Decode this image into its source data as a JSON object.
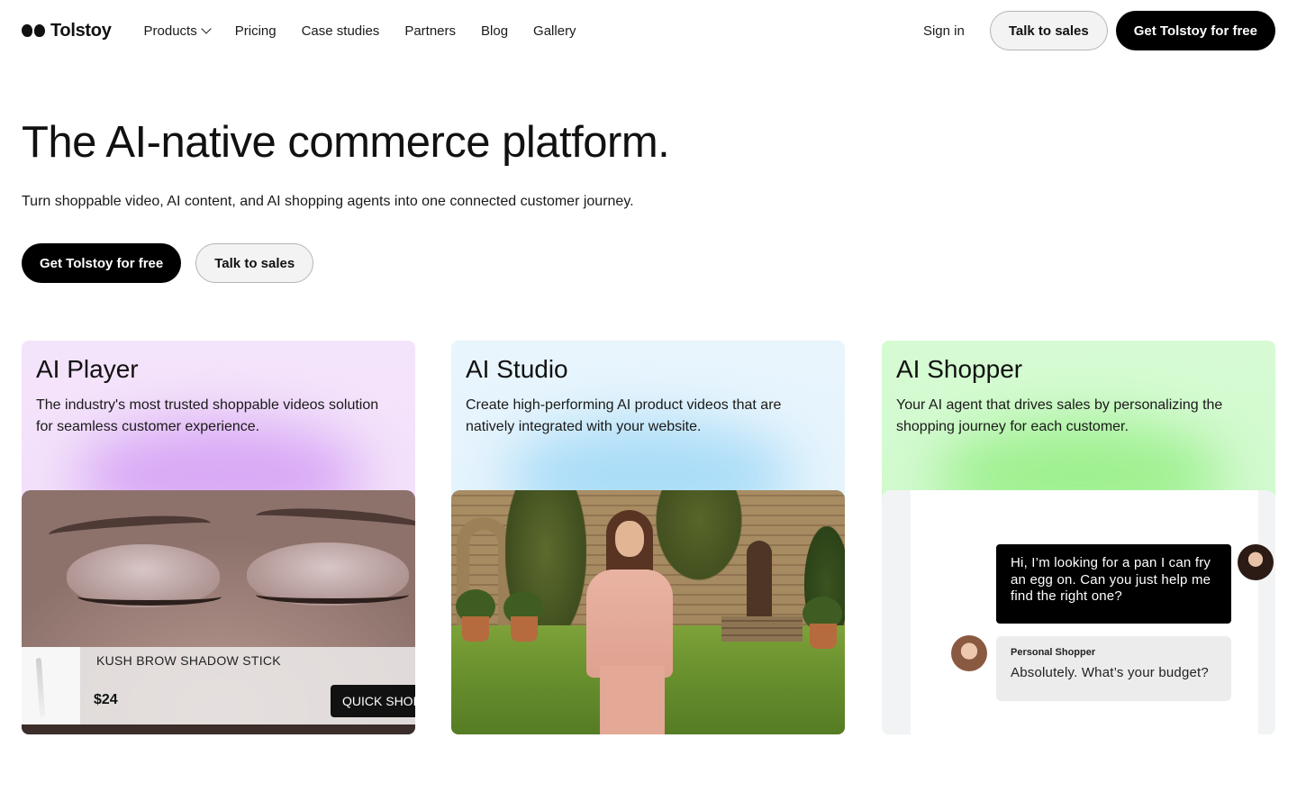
{
  "nav": {
    "logo": "Tolstoy",
    "links": [
      "Products",
      "Pricing",
      "Case studies",
      "Partners",
      "Blog",
      "Gallery"
    ],
    "signin": "Sign in",
    "talk": "Talk to sales",
    "cta": "Get Tolstoy for free"
  },
  "hero": {
    "title": "The AI-native commerce platform.",
    "subtitle": "Turn shoppable video, AI content, and AI shopping agents into one connected customer journey.",
    "cta_primary": "Get Tolstoy for free",
    "cta_secondary": "Talk to sales"
  },
  "cards": [
    {
      "title": "AI Player",
      "desc": "The industry's most trusted shoppable videos solution for seamless customer experience.",
      "product_name": "KUSH BROW SHADOW STICK",
      "product_price": "$24",
      "quick_shop": "QUICK SHOP"
    },
    {
      "title": "AI Studio",
      "desc": "Create high-performing AI product videos that are natively integrated with your website."
    },
    {
      "title": "AI Shopper",
      "desc": "Your AI agent that drives sales by personalizing the shopping journey for each customer.",
      "user_msg": "Hi, I’m looking for a pan I can fry an egg on. Can you just help me find the right one?",
      "agent_label": "Personal Shopper",
      "agent_msg": "Absolutely. What’s your budget?"
    }
  ]
}
